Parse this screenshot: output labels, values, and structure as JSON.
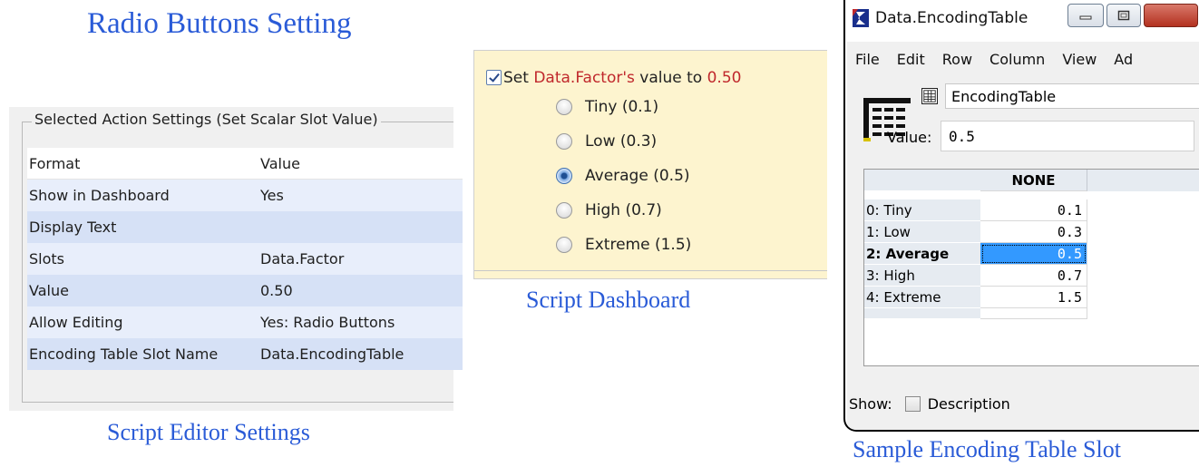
{
  "captions": {
    "radio": "Radio Buttons Setting",
    "editor": "Script Editor Settings",
    "dashboard": "Script Dashboard",
    "encoding": "Sample Encoding Table Slot"
  },
  "settings": {
    "title": "Selected Action Settings (Set Scalar Slot Value)",
    "header": [
      "Format",
      "Value"
    ],
    "rows": [
      [
        "Show in Dashboard",
        "Yes"
      ],
      [
        "Display Text",
        ""
      ],
      [
        "Slots",
        "Data.Factor"
      ],
      [
        "Value",
        "0.50"
      ],
      [
        "Allow Editing",
        "Yes: Radio Buttons"
      ],
      [
        "Encoding Table Slot Name",
        "Data.EncodingTable"
      ]
    ]
  },
  "dashboard": {
    "set_prefix": "Set ",
    "slot": "Data.Factor's",
    "mid": " value to ",
    "value": "0.50",
    "options": [
      "Tiny (0.1)",
      "Low (0.3)",
      "Average (0.5)",
      "High (0.7)",
      "Extreme (1.5)"
    ],
    "selected_index": 2
  },
  "window": {
    "title": "Data.EncodingTable",
    "menu": [
      "File",
      "Edit",
      "Row",
      "Column",
      "View",
      "Ad"
    ],
    "name": "EncodingTable",
    "value_label": "Value:",
    "value": "0.5",
    "column_header": "NONE",
    "rows": [
      {
        "label": "0: Tiny",
        "value": "0.1"
      },
      {
        "label": "1: Low",
        "value": "0.3"
      },
      {
        "label": "2: Average",
        "value": "0.5"
      },
      {
        "label": "3: High",
        "value": "0.7"
      },
      {
        "label": "4: Extreme",
        "value": "1.5"
      }
    ],
    "selected_row": 2,
    "show_label": "Show:",
    "description_label": "Description"
  },
  "colors": {
    "caption_blue": "#2a5bd7",
    "dashboard_bg": "#fdf4cf",
    "highlight_red": "#c0282c",
    "selection_blue": "#3399ff"
  }
}
